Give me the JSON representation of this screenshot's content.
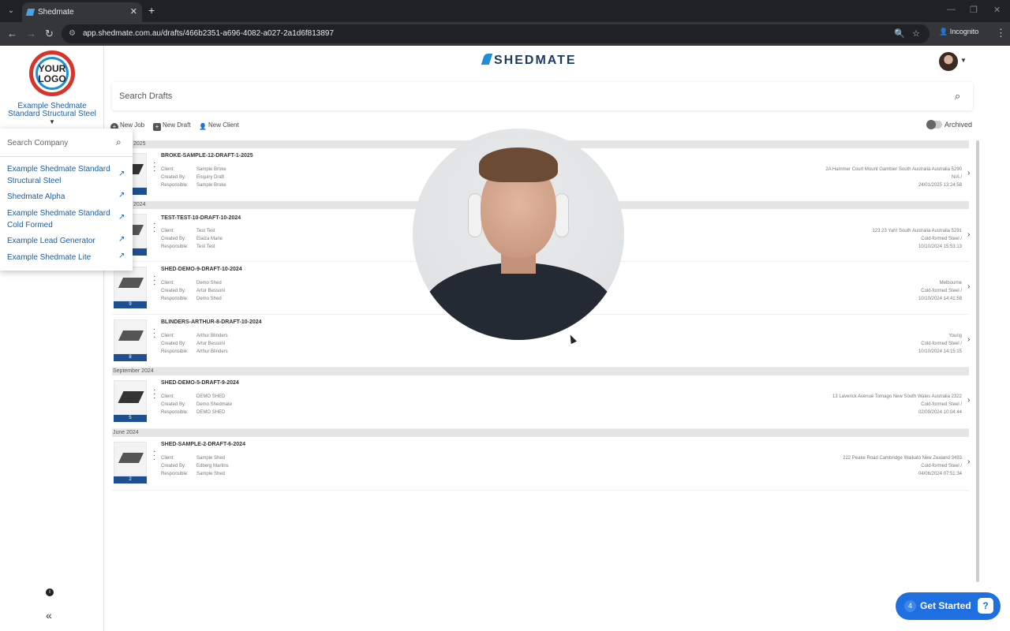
{
  "browser": {
    "tab_title": "Shedmate",
    "url": "app.shedmate.com.au/drafts/466b2351-a696-4082-a027-2a1d6f813897",
    "incognito_label": "Incognito"
  },
  "sidebar": {
    "logo_text": "YOUR LOGO",
    "company_name": "Example Shedmate Standard Structural Steel",
    "company_search_placeholder": "Search Company",
    "companies": [
      {
        "label": "Example Shedmate Standard Structural Steel"
      },
      {
        "label": "Shedmate Alpha"
      },
      {
        "label": "Example Shedmate Standard Cold Formed"
      },
      {
        "label": "Example Lead Generator"
      },
      {
        "label": "Example Shedmate Lite"
      }
    ]
  },
  "header": {
    "brand": "SHEDMATE",
    "search_placeholder": "Search Drafts"
  },
  "actions": {
    "new_job": "New Job",
    "new_draft": "New Draft",
    "new_client": "New Client",
    "archived": "Archived"
  },
  "groups": [
    {
      "label": "2025"
    },
    {
      "label": "2024"
    },
    {
      "label": "September 2024"
    },
    {
      "label": "June 2024"
    }
  ],
  "meta_labels": {
    "client": "Client:",
    "created_by": "Created By:",
    "responsible": "Responsible:"
  },
  "drafts": [
    {
      "title": "BROKE-SAMPLE-12-DRAFT-1-2025",
      "client": "Sample Broke",
      "created_by": "Enquiry Draft",
      "responsible": "Sample Broke",
      "address": "2A Hammer Court Mount Gambier South Australia Australia 5290",
      "type": "N/A /",
      "date": "24/01/2025 13:24:58",
      "count": ""
    },
    {
      "title": "TEST-TEST-10-DRAFT-10-2024",
      "client": "Test Test",
      "created_by": "Elaiza Marie",
      "responsible": "Test Test",
      "address": "123 23 Yah! South Australia Australia 5291",
      "type": "Cold-formed Steel /",
      "date": "10/10/2024 15:53:13",
      "count": ""
    },
    {
      "title": "SHED-DEMO-9-DRAFT-10-2024",
      "client": "Demo Shed",
      "created_by": "Artur Bessoni",
      "responsible": "Demo Shed",
      "address": "Melbourne",
      "type": "Cold-formed Steel /",
      "date": "10/10/2024 14:41:58",
      "count": "9"
    },
    {
      "title": "BLINDERS-ARTHUR-8-DRAFT-10-2024",
      "client": "Arthur Blinders",
      "created_by": "Artur Bessoni",
      "responsible": "Arthur Blinders",
      "address": "Young",
      "type": "Cold-formed Steel /",
      "date": "10/10/2024 14:15:15",
      "count": "8"
    },
    {
      "title": "SHED-DEMO-5-DRAFT-9-2024",
      "client": "DEMO SHED",
      "created_by": "Demo Shedmate",
      "responsible": "DEMO SHED",
      "address": "13 Laverick Avenue Tomago New South Wales Australia 2322",
      "type": "Cold-formed Steel /",
      "date": "02/09/2024 10:04:44",
      "count": "5"
    },
    {
      "title": "SHED-SAMPLE-2-DRAFT-6-2024",
      "client": "Sample Shed",
      "created_by": "Edberg Martins",
      "responsible": "Sample Shed",
      "address": "222 Peake Road Cambridge Waikato New Zealand 3493",
      "type": "Cold-formed Steel /",
      "date": "04/06/2024 07:51:34",
      "count": "2"
    }
  ],
  "help_widget": {
    "badge": "4",
    "label": "Get Started"
  }
}
